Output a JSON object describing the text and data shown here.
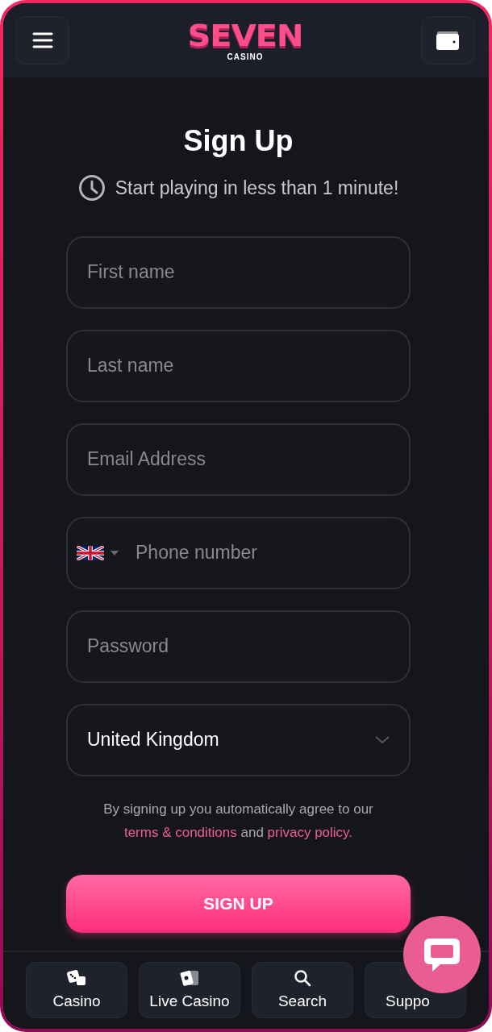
{
  "header": {
    "logo": "SEVEN",
    "logo_sub": "CASINO"
  },
  "title": "Sign Up",
  "subtitle": "Start playing in less than 1 minute!",
  "fields": [
    {
      "kind": "text",
      "placeholder": "First name"
    },
    {
      "kind": "text",
      "placeholder": "Last name"
    },
    {
      "kind": "text",
      "placeholder": "Email Address"
    },
    {
      "kind": "phone",
      "placeholder": "Phone number"
    },
    {
      "kind": "password",
      "placeholder": "Password"
    },
    {
      "kind": "select",
      "value": "United Kingdom"
    }
  ],
  "agreement": {
    "text": "By signing up you automatically agree to our",
    "terms_link": "terms & conditions",
    "joiner": "and",
    "privacy_link": "privacy policy."
  },
  "submit": "SIGN UP",
  "bottom_nav": [
    {
      "label": "Casino"
    },
    {
      "label": "Live Casino"
    },
    {
      "label": "Search"
    },
    {
      "label": "Suppo"
    }
  ]
}
